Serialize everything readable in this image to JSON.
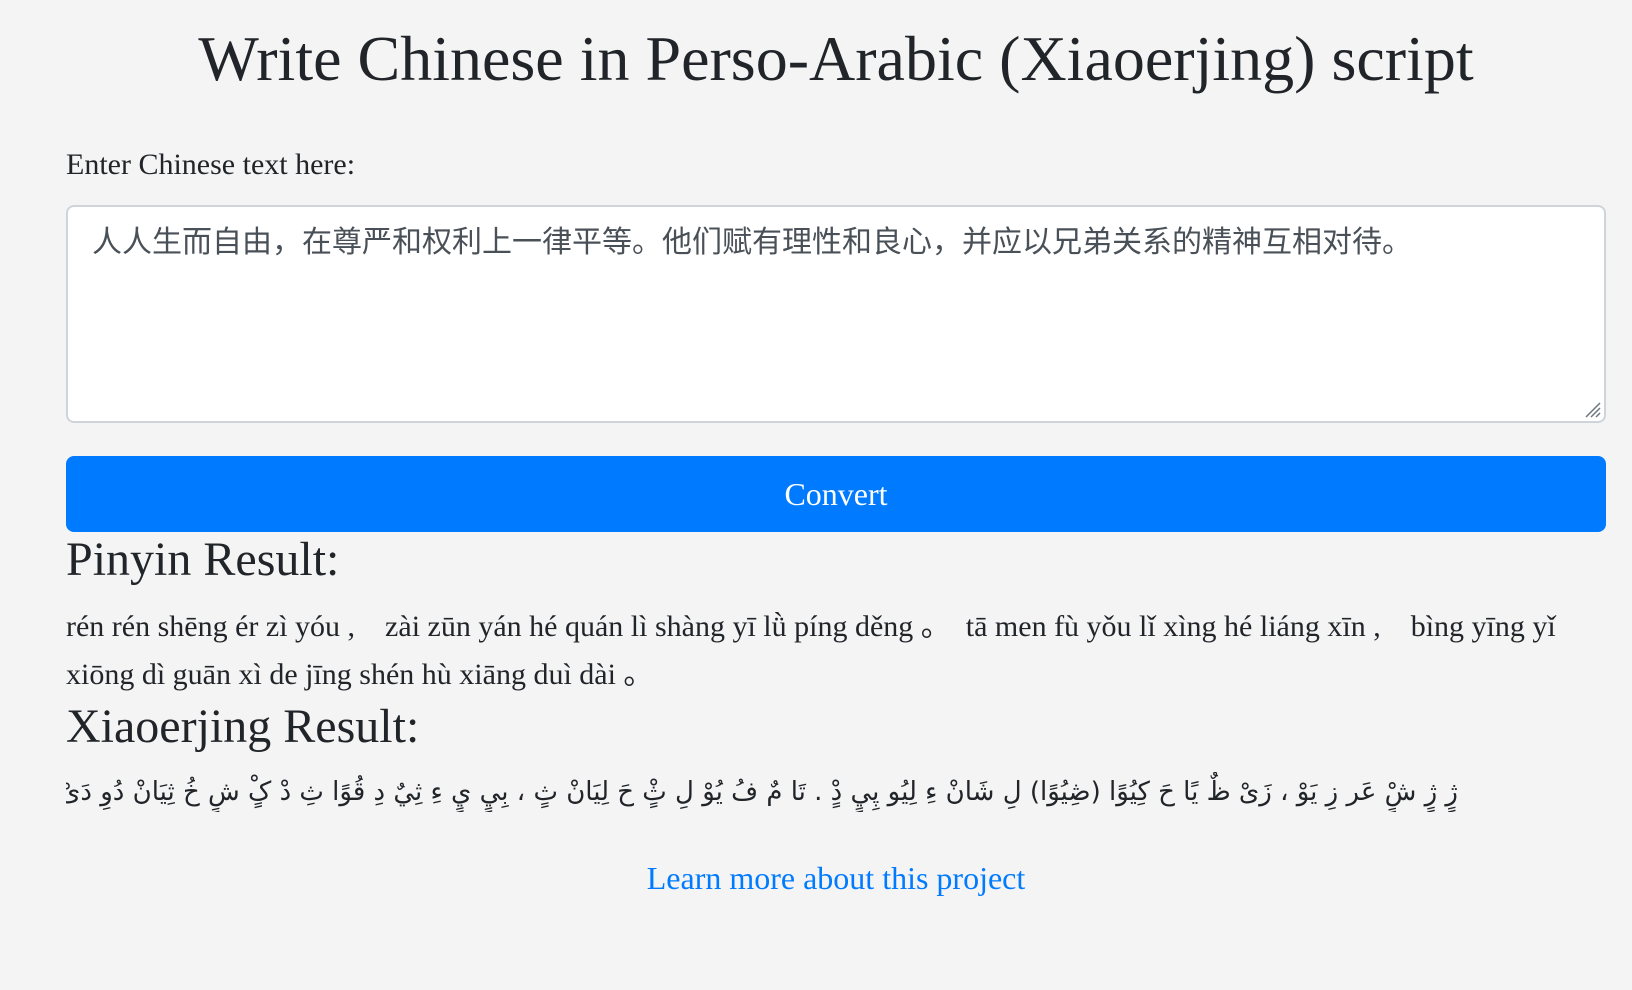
{
  "header": {
    "title": "Write Chinese in Perso-Arabic (Xiaoerjing) script"
  },
  "input": {
    "label": "Enter Chinese text here:",
    "value": "人人生而自由，在尊严和权利上一律平等。他们赋有理性和良心，并应以兄弟关系的精神互相对待。"
  },
  "convert": {
    "label": "Convert"
  },
  "pinyin": {
    "heading": "Pinyin Result:",
    "text": "rén rén shēng ér zì yóu ,    zài zūn yán hé quán lì shàng yī lǜ píng děng 。  tā men fù yǒu lǐ xìng hé liáng xīn ,    bìng yīng yǐ xiōng dì guān xì de jīng shén hù xiāng duì dài 。"
  },
  "xiaoerjing": {
    "heading": "Xiaoerjing Result:",
    "text": "ژٍ ژٍ شٍْ عَر زِ يَوْ ، زَىْ ظٌ يًا حَ کِيُوًا (ڞِيُوًا) لِ شَانْ ءِ لِيُو پِيٍ دٍْ . تَا مٌ فُ يُوْ لِ ثٍْ حَ لِيَانْ ثٍ ، بِيٍ يٍ ءِ ثِيٌ دِ قُوًا ثِ دْ کٍْ شٍ خُ ثِيَانْ دُوِ دَىْ ."
  },
  "footer": {
    "link_label": "Learn more about this project"
  },
  "colors": {
    "background": "#f4f4f4",
    "accent": "#007bff",
    "text": "#212529"
  }
}
